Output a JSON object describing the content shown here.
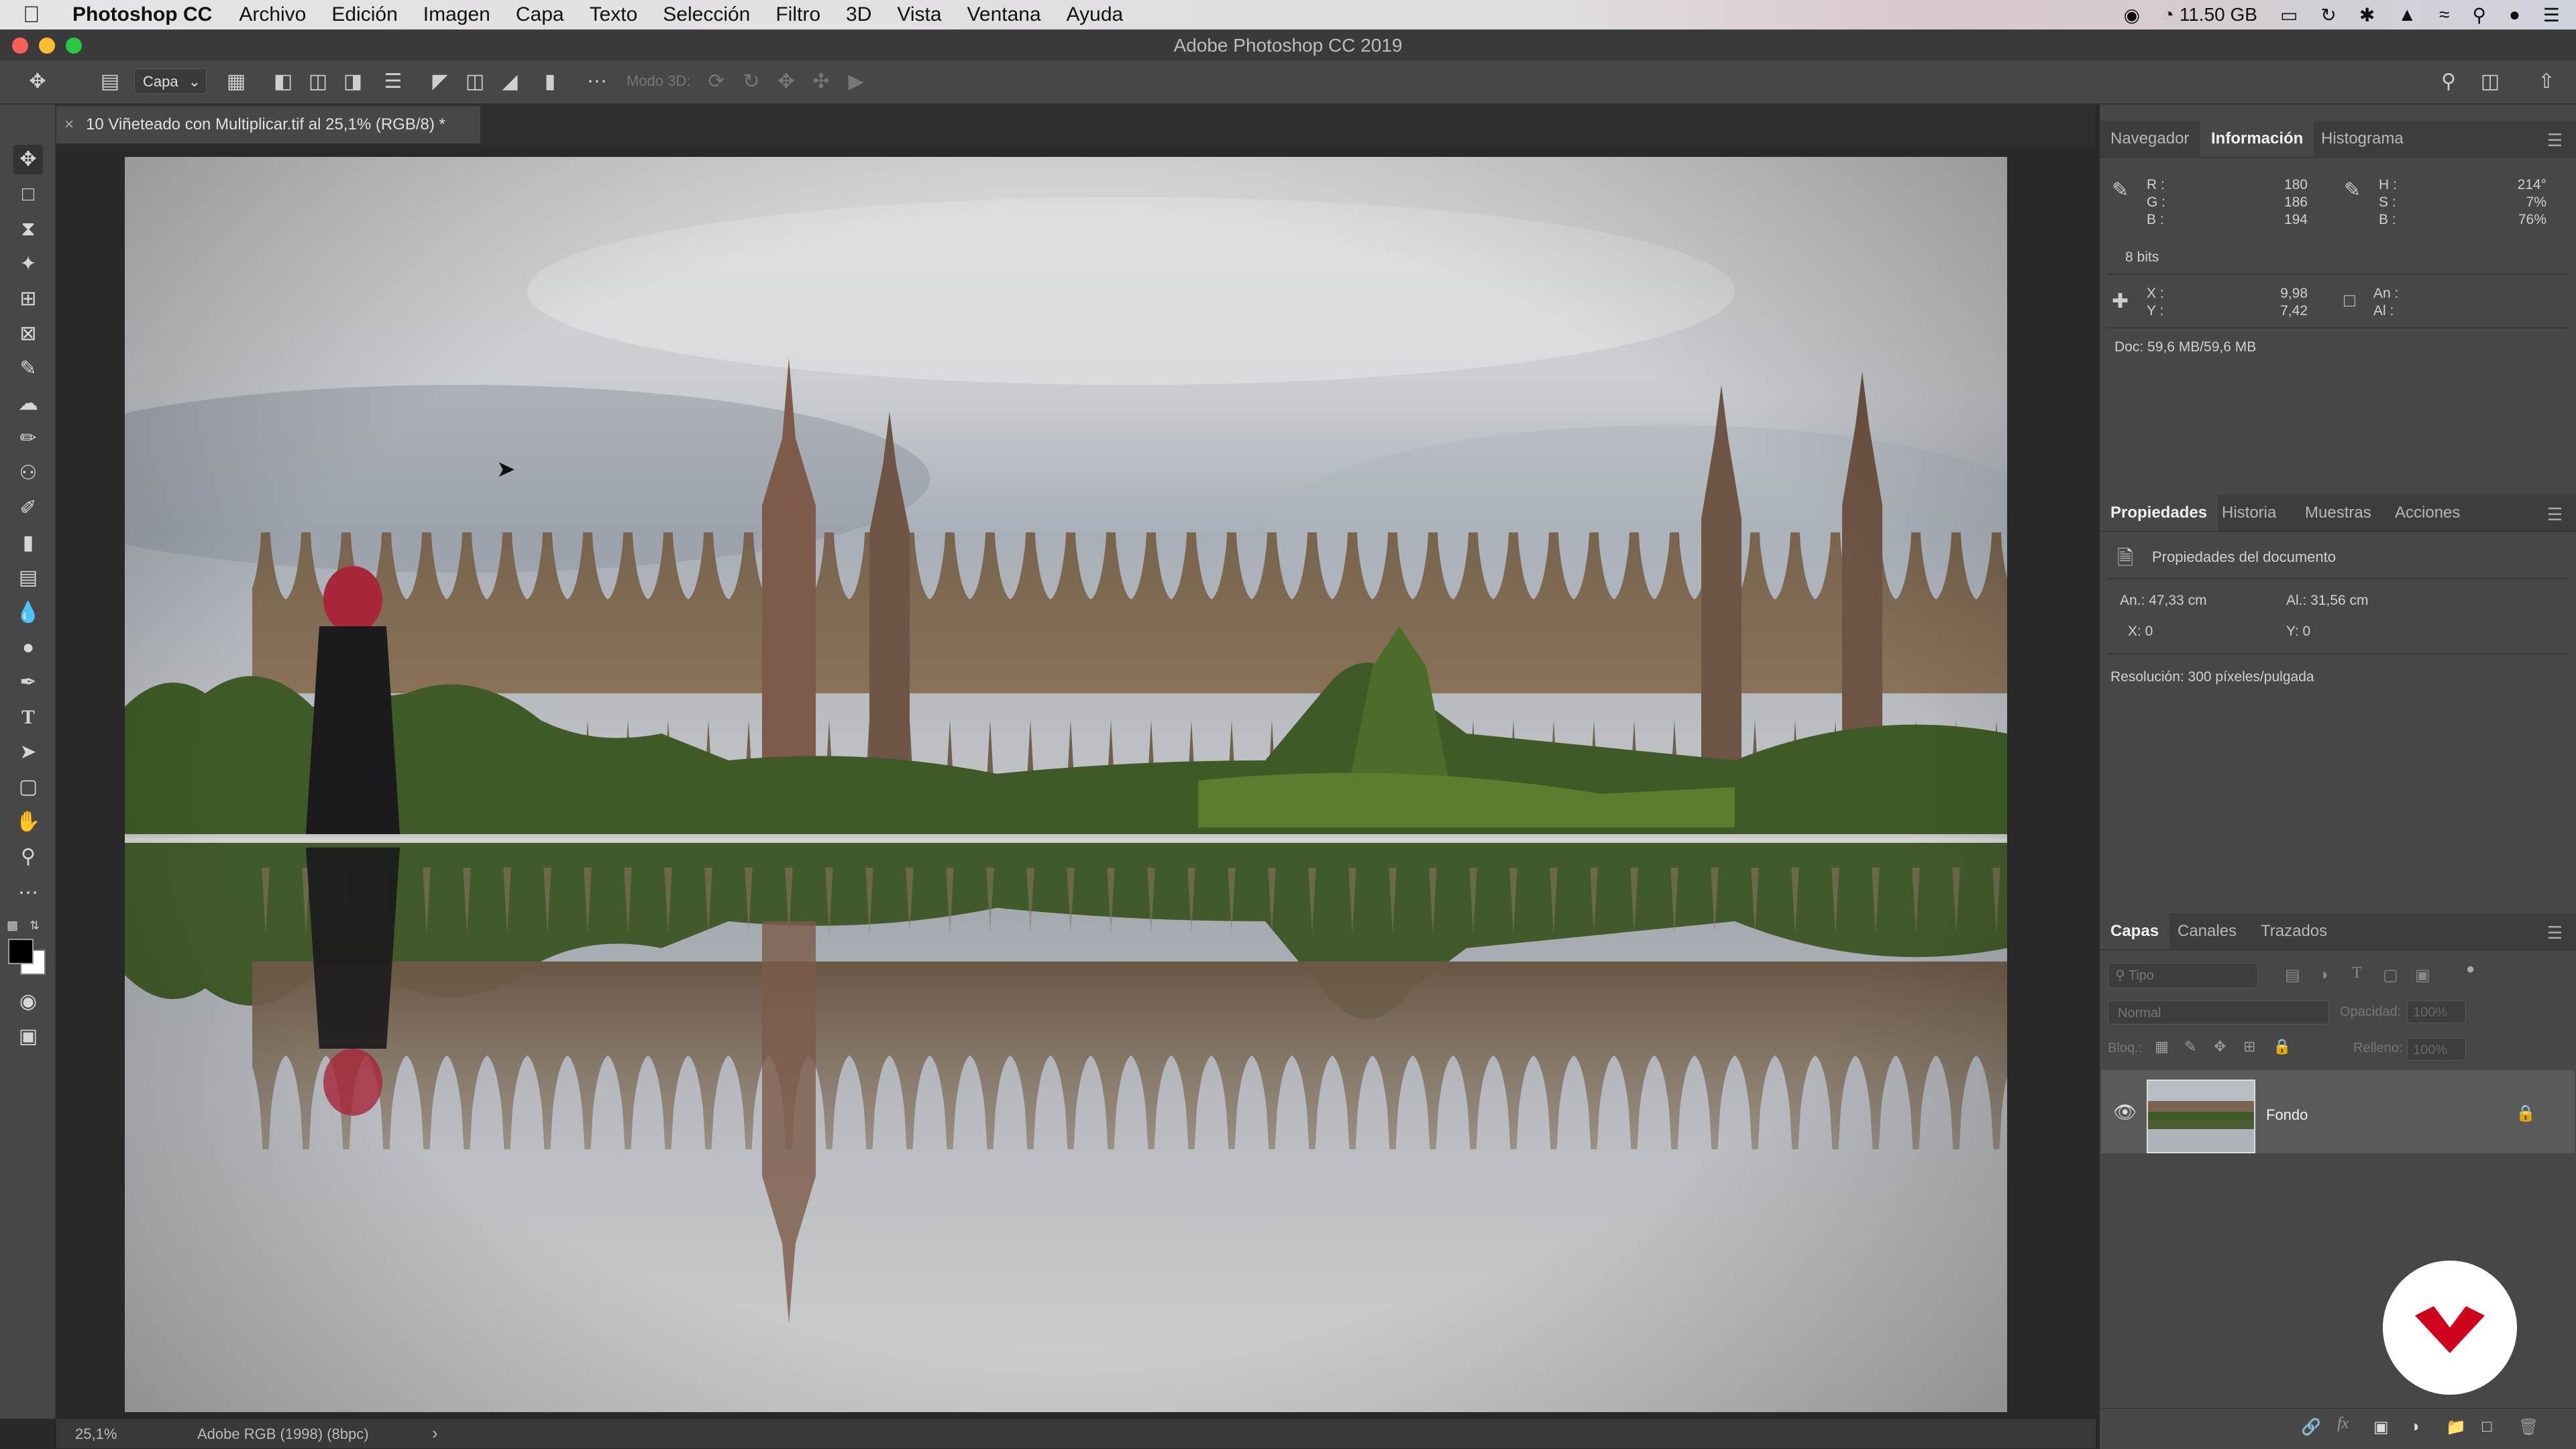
{
  "menubar": {
    "app": "Photoshop CC",
    "items": [
      "Archivo",
      "Edición",
      "Imagen",
      "Capa",
      "Texto",
      "Selección",
      "Filtro",
      "3D",
      "Vista",
      "Ventana",
      "Ayuda"
    ],
    "memory": "11.50 GB"
  },
  "window": {
    "title": "Adobe Photoshop CC 2019"
  },
  "options_bar": {
    "layer_select": "Capa",
    "mode3d": "Modo 3D:"
  },
  "document_tab": {
    "close": "×",
    "title": "10 Viñeteado con Multiplicar.tif al 25,1% (RGB/8) *"
  },
  "status_bar": {
    "zoom": "25,1%",
    "profile": "Adobe RGB (1998) (8bpc)",
    "arrow": "›"
  },
  "panels": {
    "top_tabs": [
      "Navegador",
      "Información",
      "Histograma"
    ],
    "top_active": "Información",
    "info": {
      "r_label": "R :",
      "r": "180",
      "g_label": "G :",
      "g": "186",
      "b_label": "B :",
      "b": "194",
      "h_label": "H :",
      "h": "214°",
      "s_label": "S :",
      "s": "7%",
      "b2_label": "B :",
      "b2": "76%",
      "bits": "8 bits",
      "x_label": "X :",
      "x": "9,98",
      "y_label": "Y :",
      "y": "7,42",
      "an_label": "An :",
      "al_label": "Al :",
      "doc": "Doc: 59,6 MB/59,6 MB"
    },
    "mid_tabs": [
      "Propiedades",
      "Historia",
      "Muestras",
      "Acciones"
    ],
    "mid_active": "Propiedades",
    "properties": {
      "header": "Propiedades del documento",
      "an": "An.: 47,33 cm",
      "al": "Al.: 31,56 cm",
      "x": "X: 0",
      "y": "Y: 0",
      "resolution": "Resolución: 300 píxeles/pulgada"
    },
    "layers_tabs": [
      "Capas",
      "Canales",
      "Trazados"
    ],
    "layers_active": "Capas",
    "layers": {
      "filter_placeholder": "Tipo",
      "blend_mode": "Normal",
      "opacity_label": "Opacidad:",
      "opacity_value": "100%",
      "lock_label": "Bloq.:",
      "fill_label": "Relleno:",
      "fill_value": "100%",
      "items": [
        {
          "name": "Fondo"
        }
      ]
    }
  },
  "colors": {
    "accent_logo": "#d0021b",
    "panel_bg": "#474747",
    "app_bg": "#282828"
  }
}
